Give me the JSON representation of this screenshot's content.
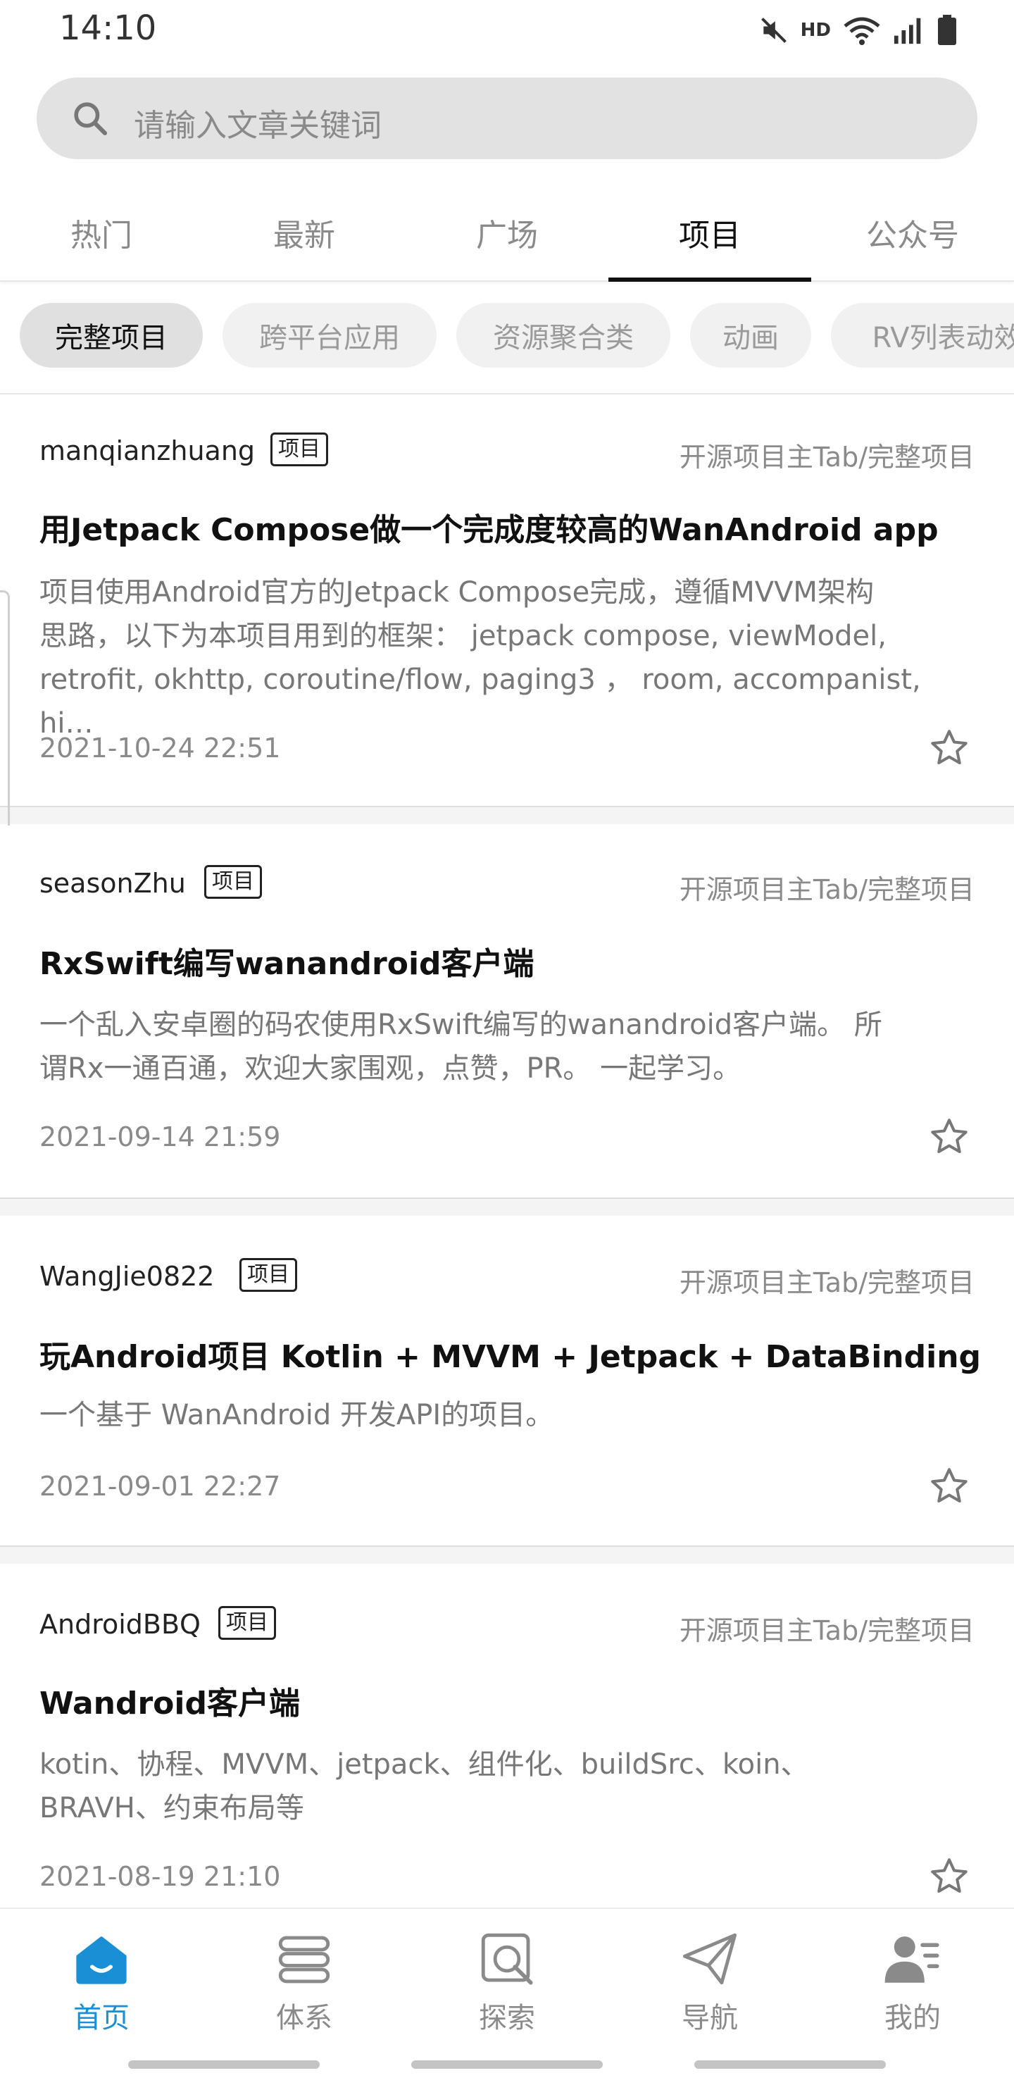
{
  "status_bar": {
    "time": "14:10",
    "network": "HD"
  },
  "search": {
    "placeholder": "请输入文章关键词"
  },
  "main_tabs": [
    "热门",
    "最新",
    "广场",
    "项目",
    "公众号"
  ],
  "active_main_tab": "项目",
  "chips": [
    "完整项目",
    "跨平台应用",
    "资源聚合类",
    "动画",
    "RV列表动效"
  ],
  "active_chip": "完整项目",
  "articles": [
    {
      "author": "manqianzhuang",
      "tag": "项目",
      "category": "开源项目主Tab/完整项目",
      "title": "用Jetpack Compose做一个完成度较高的WanAndroid app",
      "desc_lines": [
        "项目使用Android官方的Jetpack Compose完成，遵循MVVM架构",
        "思路，以下为本项目用到的框架： jetpack compose, viewModel,",
        "retrofit, okhttp, coroutine/flow, paging3 ， room, accompanist, hi…"
      ],
      "date": "2021-10-24 22:51"
    },
    {
      "author": "seasonZhu",
      "tag": "项目",
      "category": "开源项目主Tab/完整项目",
      "title": "RxSwift编写wanandroid客户端",
      "desc_lines": [
        "一个乱入安卓圈的码农使用RxSwift编写的wanandroid客户端。 所",
        "谓Rx一通百通，欢迎大家围观，点赞，PR。 一起学习。"
      ],
      "date": "2021-09-14 21:59"
    },
    {
      "author": "WangJie0822",
      "tag": "项目",
      "category": "开源项目主Tab/完整项目",
      "title": "玩Android项目 Kotlin + MVVM + Jetpack + DataBinding",
      "desc_lines": [
        "一个基于 WanAndroid 开发API的项目。"
      ],
      "date": "2021-09-01 22:27"
    },
    {
      "author": "AndroidBBQ",
      "tag": "项目",
      "category": "开源项目主Tab/完整项目",
      "title": "Wandroid客户端",
      "desc_lines": [
        "kotin、协程、MVVM、jetpack、组件化、buildSrc、koin、",
        "BRAVH、约束布局等"
      ],
      "date": "2021-08-19 21:10"
    }
  ],
  "bottom_nav": [
    {
      "label": "首页",
      "icon": "home-icon"
    },
    {
      "label": "体系",
      "icon": "layers-icon"
    },
    {
      "label": "探索",
      "icon": "explore-icon"
    },
    {
      "label": "导航",
      "icon": "navigation-icon"
    },
    {
      "label": "我的",
      "icon": "profile-icon"
    }
  ],
  "active_nav": "首页",
  "colors": {
    "accent": "#1a8fd6",
    "inactive": "#8a8a8a",
    "search_bg": "#e2e2e2"
  }
}
